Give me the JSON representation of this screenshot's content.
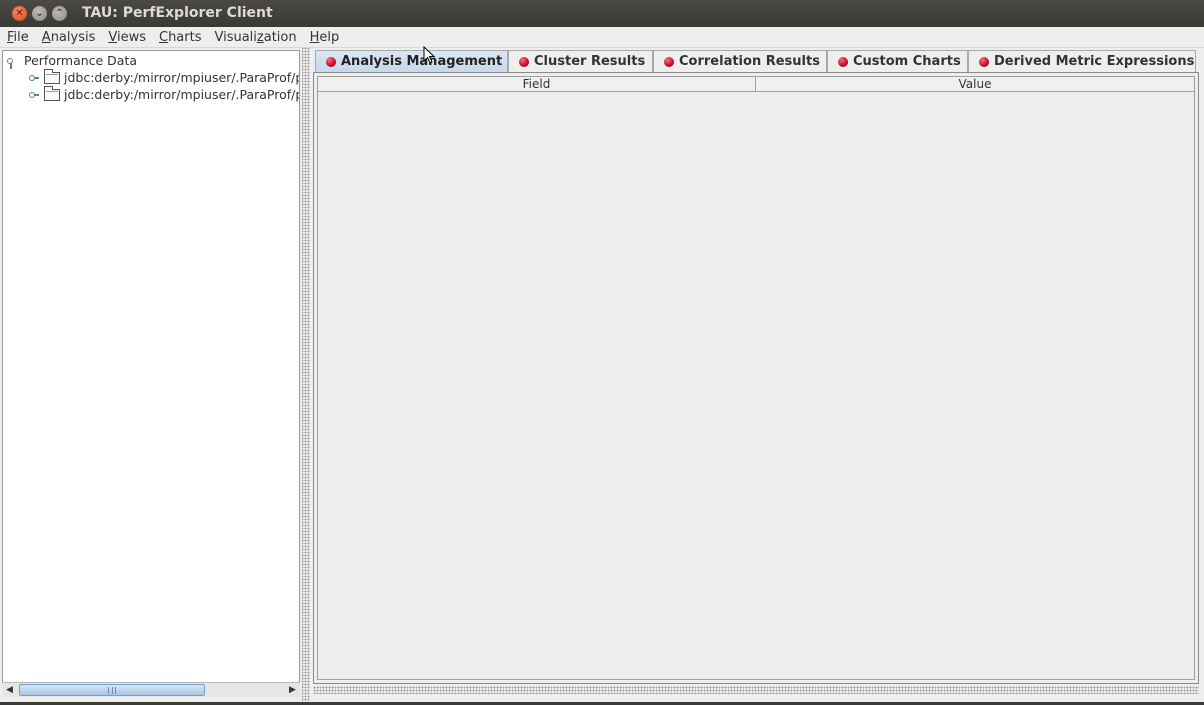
{
  "window": {
    "title": "TAU: PerfExplorer Client"
  },
  "menubar": {
    "items": [
      {
        "mnemonic": "F",
        "rest": "ile"
      },
      {
        "mnemonic": "A",
        "rest": "nalysis"
      },
      {
        "mnemonic": "V",
        "rest": "iews"
      },
      {
        "mnemonic": "C",
        "rest": "harts"
      },
      {
        "pre": "Visuali",
        "mnemonic": "z",
        "rest": "ation"
      },
      {
        "mnemonic": "H",
        "rest": "elp"
      }
    ]
  },
  "tree": {
    "root": "Performance Data",
    "children": [
      "jdbc:derby:/mirror/mpiuser/.ParaProf/p",
      "jdbc:derby:/mirror/mpiuser/.ParaProf/p"
    ]
  },
  "tabs": [
    {
      "label": "Analysis Management",
      "active": true
    },
    {
      "label": "Cluster Results",
      "active": false
    },
    {
      "label": "Correlation Results",
      "active": false
    },
    {
      "label": "Custom Charts",
      "active": false
    },
    {
      "label": "Derived Metric Expressions",
      "active": false
    }
  ],
  "table": {
    "columns": [
      "Field",
      "Value"
    ]
  },
  "icons": {
    "close": "close-icon",
    "minimize": "minimize-icon",
    "maximize": "maximize-icon",
    "folder": "folder-icon",
    "tab_status": "red-dot-icon"
  }
}
